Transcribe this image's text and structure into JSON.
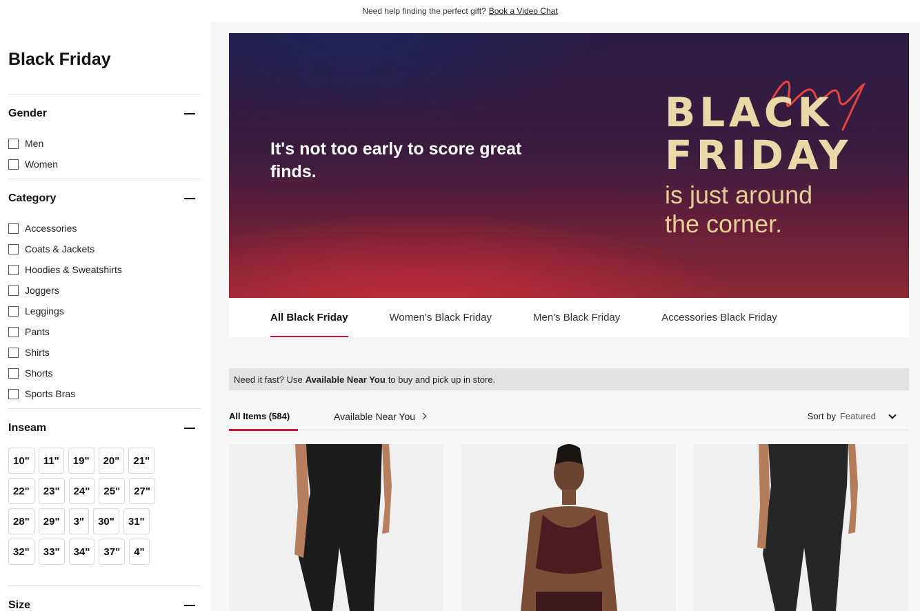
{
  "topbar": {
    "text": "Need help finding the perfect gift?",
    "link": "Book a Video Chat"
  },
  "sidebar": {
    "title": "Black Friday",
    "gender": {
      "heading": "Gender",
      "options": [
        "Men",
        "Women"
      ]
    },
    "category": {
      "heading": "Category",
      "options": [
        "Accessories",
        "Coats & Jackets",
        "Hoodies & Sweatshirts",
        "Joggers",
        "Leggings",
        "Pants",
        "Shirts",
        "Shorts",
        "Sports Bras"
      ]
    },
    "inseam": {
      "heading": "Inseam",
      "rows": [
        [
          "10\"",
          "11\"",
          "19\"",
          "20\"",
          "21\""
        ],
        [
          "22\"",
          "23\"",
          "24\"",
          "25\"",
          "27\""
        ],
        [
          "28\"",
          "29\"",
          "3\"",
          "30\"",
          "31\""
        ],
        [
          "32\"",
          "33\"",
          "34\"",
          "37\"",
          "4\""
        ]
      ]
    },
    "size": {
      "heading": "Size"
    }
  },
  "hero": {
    "tagline": "It's not too early to score great finds.",
    "bf_line1": "BLACK",
    "bf_line2": "FRIDAY",
    "bf_sub1": "is just around",
    "bf_sub2": "the corner.",
    "accent_color": "#e8443e"
  },
  "tabs": [
    "All Black Friday",
    "Women's Black Friday",
    "Men's Black Friday",
    "Accessories Black Friday"
  ],
  "availability": {
    "prefix": "Need it fast? Use",
    "bold": "Available Near You",
    "suffix": "to buy and pick up in store."
  },
  "filters": {
    "all_items": "All Items (584)",
    "near_you": "Available Near You",
    "sort_label": "Sort by",
    "sort_value": "Featured"
  },
  "colors": {
    "brand_red": "#d31334",
    "gold": "#ead9a8"
  }
}
